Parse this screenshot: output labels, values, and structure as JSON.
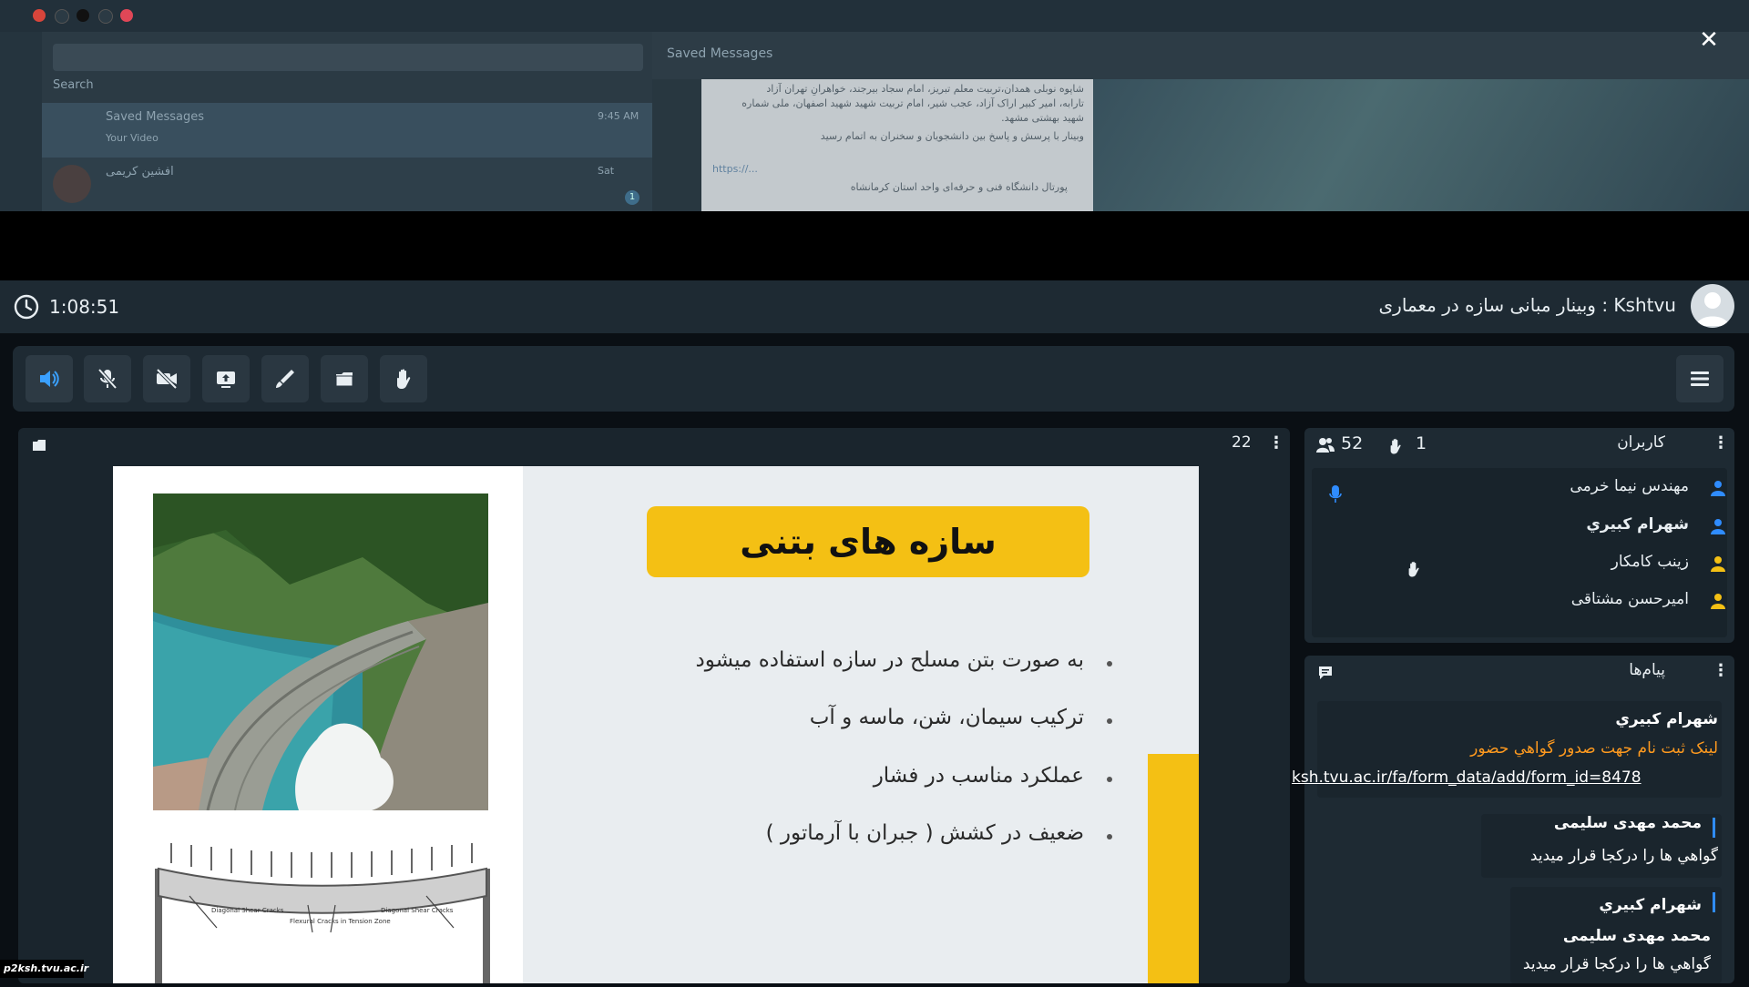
{
  "background_app": {
    "chat_title": "Saved Messages",
    "search_placeholder": "Search",
    "chat_rows": [
      {
        "name": "Saved Messages",
        "time": "9:45 AM",
        "preview": "Your Video"
      },
      {
        "name": "افشین کریمی",
        "time": "Sat",
        "badge": "1"
      }
    ],
    "message_lines": [
      "شاپوه نوبلی همدان،تربیت معلم تبریز، امام سجاد بیرجند، خواهرانِ تهران آزاد",
      "تارابه، امیر کبیر اراک آزاد، عجب شیر، امام تربیت شهید شهید اصفهان، ملی شماره",
      "شهید بهشتی مشهد.",
      "وبینار با پرسش و پاسخ بین دانشجویان و سخنران به اتمام رسید",
      "https://..."
    ],
    "footer_line": "پورتال دانشگاه فنی و حرفه‌ای واحد استان کرمانشاه"
  },
  "meeting": {
    "timer": "1:08:51",
    "host": "Kshtvu",
    "title": "وبینار مبانی سازه در معماری",
    "title_full": "Kshtvu : وبینار مبانی سازه در معماری"
  },
  "toolbar": {
    "buttons": [
      {
        "name": "speaker",
        "icon": "speaker-icon"
      },
      {
        "name": "mic",
        "icon": "mic-off-icon"
      },
      {
        "name": "camera",
        "icon": "camera-off-icon"
      },
      {
        "name": "share-screen",
        "icon": "share-screen-icon"
      },
      {
        "name": "draw",
        "icon": "pen-icon"
      },
      {
        "name": "files",
        "icon": "folder-icon"
      },
      {
        "name": "raise-hand",
        "icon": "hand-icon"
      }
    ],
    "menu_icon": "hamburger-icon"
  },
  "share_pod": {
    "page_count": "22",
    "slide": {
      "title": "سازه های بتنی",
      "bullets": [
        "به صورت بتن مسلح در سازه استفاده میشود",
        "ترکیب سیمان، شن، ماسه و آب",
        "عملکرد مناسب در فشار",
        "ضعیف در کشش ( جبران با آرماتور )"
      ],
      "diagram_labels": [
        "Diagonal Shear Cracks",
        "Flexural Cracks in Tension Zone",
        "Diagonal Shear Cracks"
      ]
    }
  },
  "users_pod": {
    "title": "کاربران",
    "user_count": "52",
    "hand_count": "1",
    "users": [
      {
        "name": "مهندس نیما خرمی",
        "role_color": "#2f8cff",
        "bold": false
      },
      {
        "name": "شهرام کبیري",
        "role_color": "#2f8cff",
        "bold": true
      },
      {
        "name": "زینب کامکار",
        "role_color": "#f4c014",
        "bold": false
      },
      {
        "name": "امیرحسن مشتاقی",
        "role_color": "#f4c014",
        "bold": false
      }
    ]
  },
  "messages_pod": {
    "title": "پیام‌ها",
    "messages": [
      {
        "sender": "شهرام کبیري",
        "text": "لینک ثبت نام جهت صدور گواهي حضور",
        "link": "ksh.tvu.ac.ir/fa/form_data/add/form_id=8478"
      },
      {
        "sender": "محمد مهدی سلیمی",
        "text": "گواهي ها را درکجا قرار میدید"
      },
      {
        "sender": "شهرام کبیري",
        "quote_sender": "محمد مهدی سلیمی",
        "quote_text": "گواهي ها را درکجا قرار میدید"
      }
    ]
  },
  "watermark": "p2ksh.tvu.ac.ir",
  "colors": {
    "accent_blue": "#2f8cff",
    "accent_yellow": "#f4c014",
    "link_orange": "#ff9a1f",
    "pod_bg": "#1e2a33"
  }
}
